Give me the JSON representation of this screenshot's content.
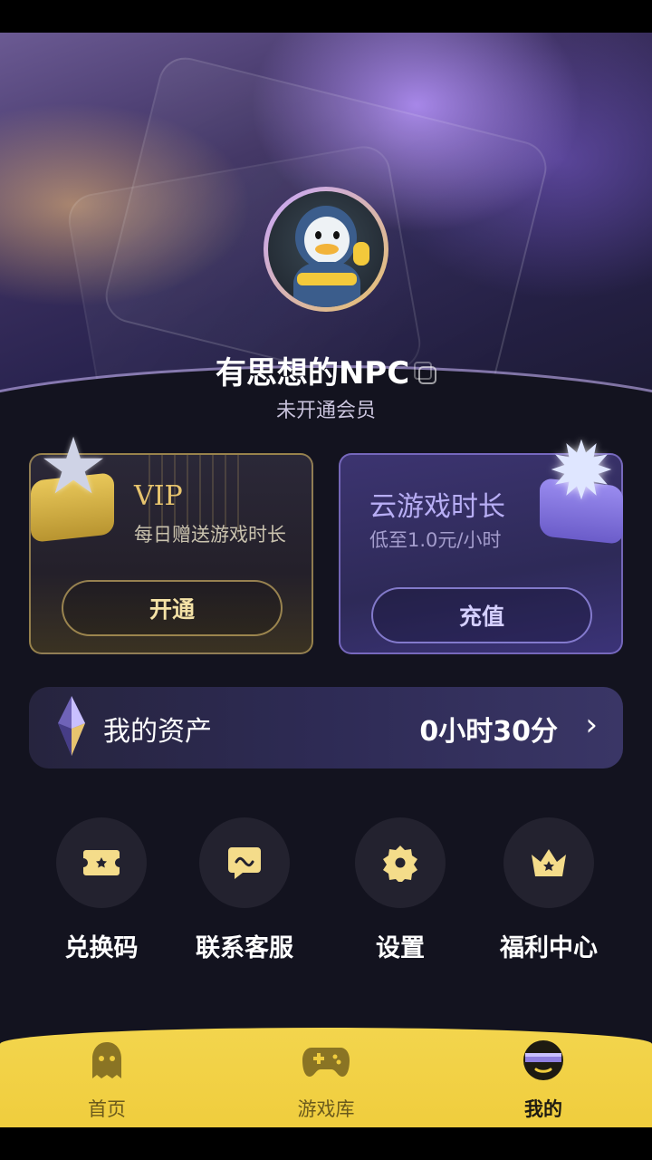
{
  "profile": {
    "username": "有思想的NPC",
    "member_status": "未开通会员"
  },
  "cards": {
    "vip": {
      "title": "VIP",
      "subtitle": "每日赠送游戏时长",
      "button": "开通"
    },
    "cloud": {
      "title": "云游戏时长",
      "subtitle": "低至1.0元/小时",
      "button": "充值"
    }
  },
  "assets": {
    "label": "我的资产",
    "value": "0小时30分",
    "chevron": "›"
  },
  "features": [
    {
      "label": "兑换码",
      "icon": "ticket-icon"
    },
    {
      "label": "联系客服",
      "icon": "chat-icon"
    },
    {
      "label": "设置",
      "icon": "gear-icon"
    },
    {
      "label": "福利中心",
      "icon": "crown-icon"
    }
  ],
  "tabs": [
    {
      "label": "首页",
      "icon": "ghost-icon",
      "active": false
    },
    {
      "label": "游戏库",
      "icon": "gamepad-icon",
      "active": false
    },
    {
      "label": "我的",
      "icon": "profile-icon",
      "active": true
    }
  ],
  "colors": {
    "accent_gold": "#e7c46e",
    "tab_bar": "#f0cd3d",
    "background": "#13131f",
    "cloud_accent": "#b8aef5"
  }
}
